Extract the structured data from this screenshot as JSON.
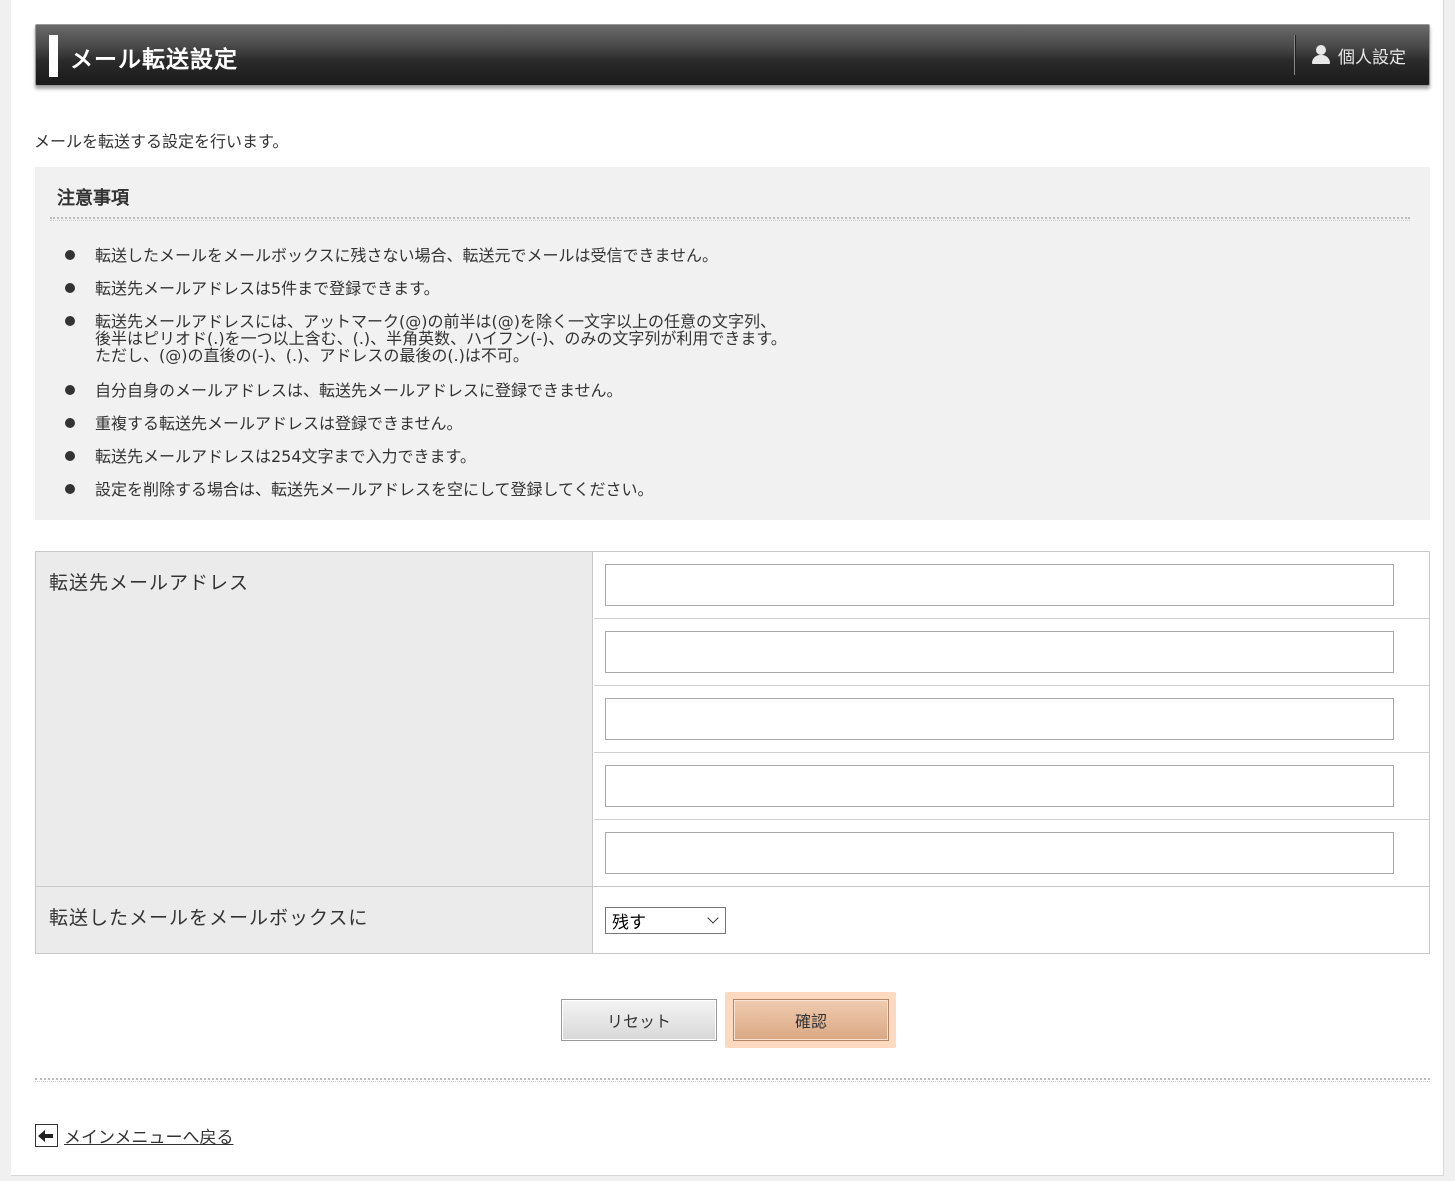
{
  "header": {
    "title": "メール転送設定",
    "personal_label": "個人設定"
  },
  "intro": "メールを転送する設定を行います。",
  "notes": {
    "heading": "注意事項",
    "items": [
      [
        "転送したメールをメールボックスに残さない場合、転送元でメールは受信できません。"
      ],
      [
        "転送先メールアドレスは5件まで登録できます。"
      ],
      [
        "転送先メールアドレスには、アットマーク(@)の前半は(@)を除く一文字以上の任意の文字列、",
        "後半はピリオド(.)を一つ以上含む、(.)、半角英数、ハイフン(-)、のみの文字列が利用できます。",
        "ただし、(@)の直後の(-)、(.)、アドレスの最後の(.)は不可。"
      ],
      [
        "自分自身のメールアドレスは、転送先メールアドレスに登録できません。"
      ],
      [
        "重複する転送先メールアドレスは登録できません。"
      ],
      [
        "転送先メールアドレスは254文字まで入力できます。"
      ],
      [
        "設定を削除する場合は、転送先メールアドレスを空にして登録してください。"
      ]
    ]
  },
  "form": {
    "address_label": "転送先メールアドレス",
    "addresses": [
      "",
      "",
      "",
      "",
      ""
    ],
    "keep_label": "転送したメールをメールボックスに",
    "keep_value": "残す"
  },
  "buttons": {
    "reset": "リセット",
    "confirm": "確認"
  },
  "back_link": "メインメニューへ戻る"
}
